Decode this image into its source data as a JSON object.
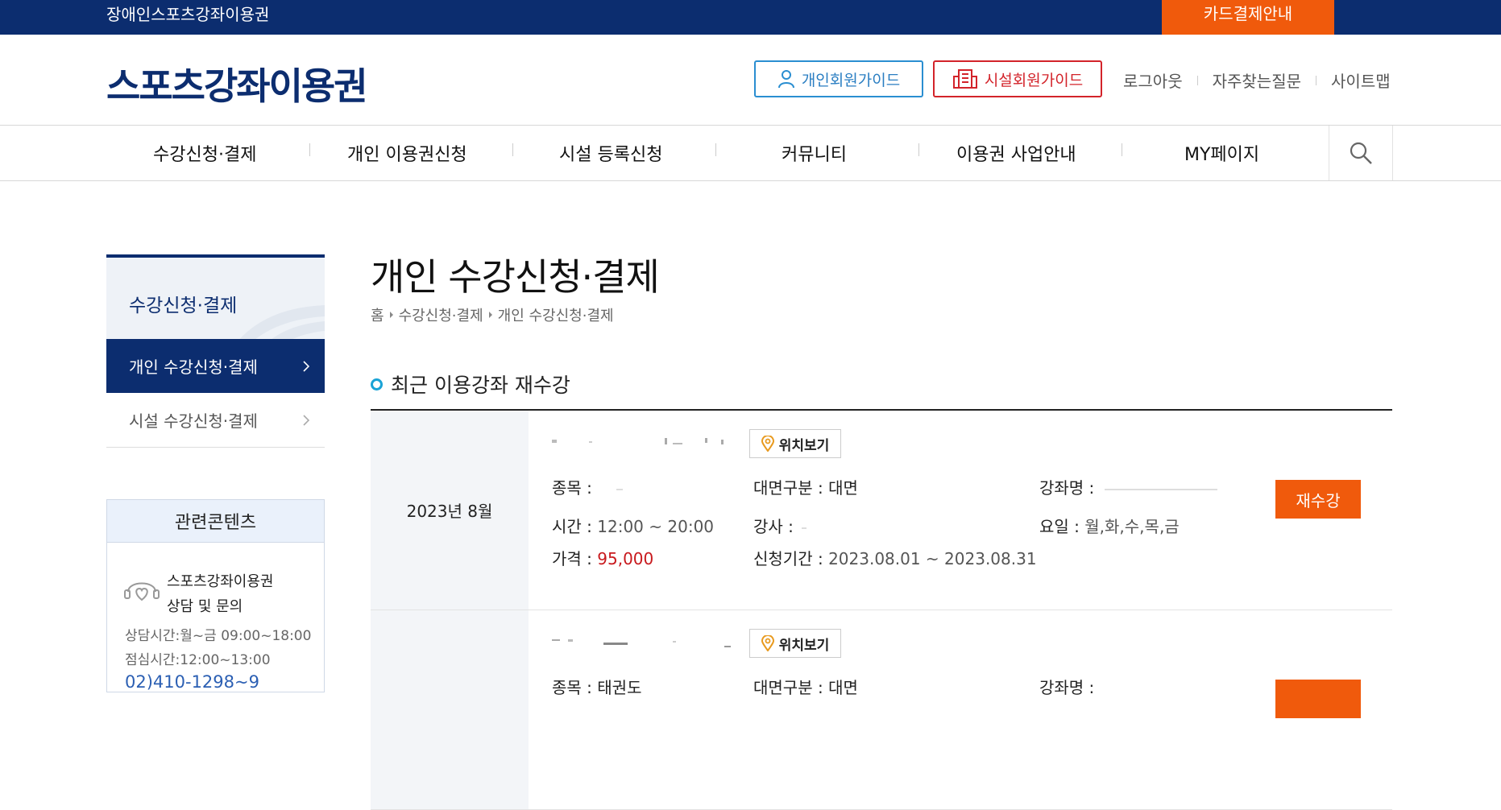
{
  "topbar": {
    "site_label": "장애인스포츠강좌이용권",
    "card_payment": "카드결제안내"
  },
  "header": {
    "logo": "스포츠강좌이용권",
    "personal_guide": "개인회원가이드",
    "facility_guide": "시설회원가이드",
    "logout": "로그아웃",
    "faq": "자주찾는질문",
    "sitemap": "사이트맵"
  },
  "nav": {
    "items": [
      {
        "label": "수강신청·결제"
      },
      {
        "label": "개인 이용권신청"
      },
      {
        "label": "시설 등록신청"
      },
      {
        "label": "커뮤니티"
      },
      {
        "label": "이용권 사업안내"
      },
      {
        "label": "MY페이지"
      }
    ]
  },
  "lnb": {
    "title": "수강신청·결제",
    "items": [
      {
        "label": "개인 수강신청·결제",
        "active": true
      },
      {
        "label": "시설 수강신청·결제",
        "active": false
      }
    ]
  },
  "related": {
    "title": "관련콘텐츠",
    "consult_line1": "스포츠강좌이용권",
    "consult_line2": "상담 및 문의",
    "hours1": "상담시간:월~금 09:00~18:00",
    "hours2": "점심시간:12:00~13:00",
    "phone": "02)410-1298~9"
  },
  "page": {
    "title": "개인 수강신청·결제",
    "breadcrumb": [
      "홈",
      "수강신청·결제",
      "개인 수강신청·결제"
    ],
    "section_title": "최근 이용강좌 재수강"
  },
  "rows": [
    {
      "date": "2023년 8월",
      "location_label": "위치보기",
      "sport_label": "종목 :",
      "sport_value": "",
      "time_label": "시간 :",
      "time_value": "12:00 ~ 20:00",
      "price_label": "가격 :",
      "price_value": "95,000",
      "mode_label": "대면구분 :",
      "mode_value": "대면",
      "instructor_label": "강사 :",
      "instructor_value": "",
      "period_label": "신청기간 :",
      "period_value": "2023.08.01 ~ 2023.08.31",
      "course_label": "강좌명 :",
      "course_value": "",
      "days_label": "요일 :",
      "days_value": "월,화,수,목,금",
      "resubscribe": "재수강"
    },
    {
      "date": "",
      "location_label": "위치보기",
      "sport_label": "종목 :",
      "sport_value": "태권도",
      "mode_label": "대면구분 :",
      "mode_value": "대면",
      "course_label": "강좌명 :",
      "course_value": ""
    }
  ],
  "colors": {
    "navy": "#0c2d6f",
    "orange": "#f05a0c",
    "red": "#c8191d",
    "blue": "#2a8ed1"
  }
}
